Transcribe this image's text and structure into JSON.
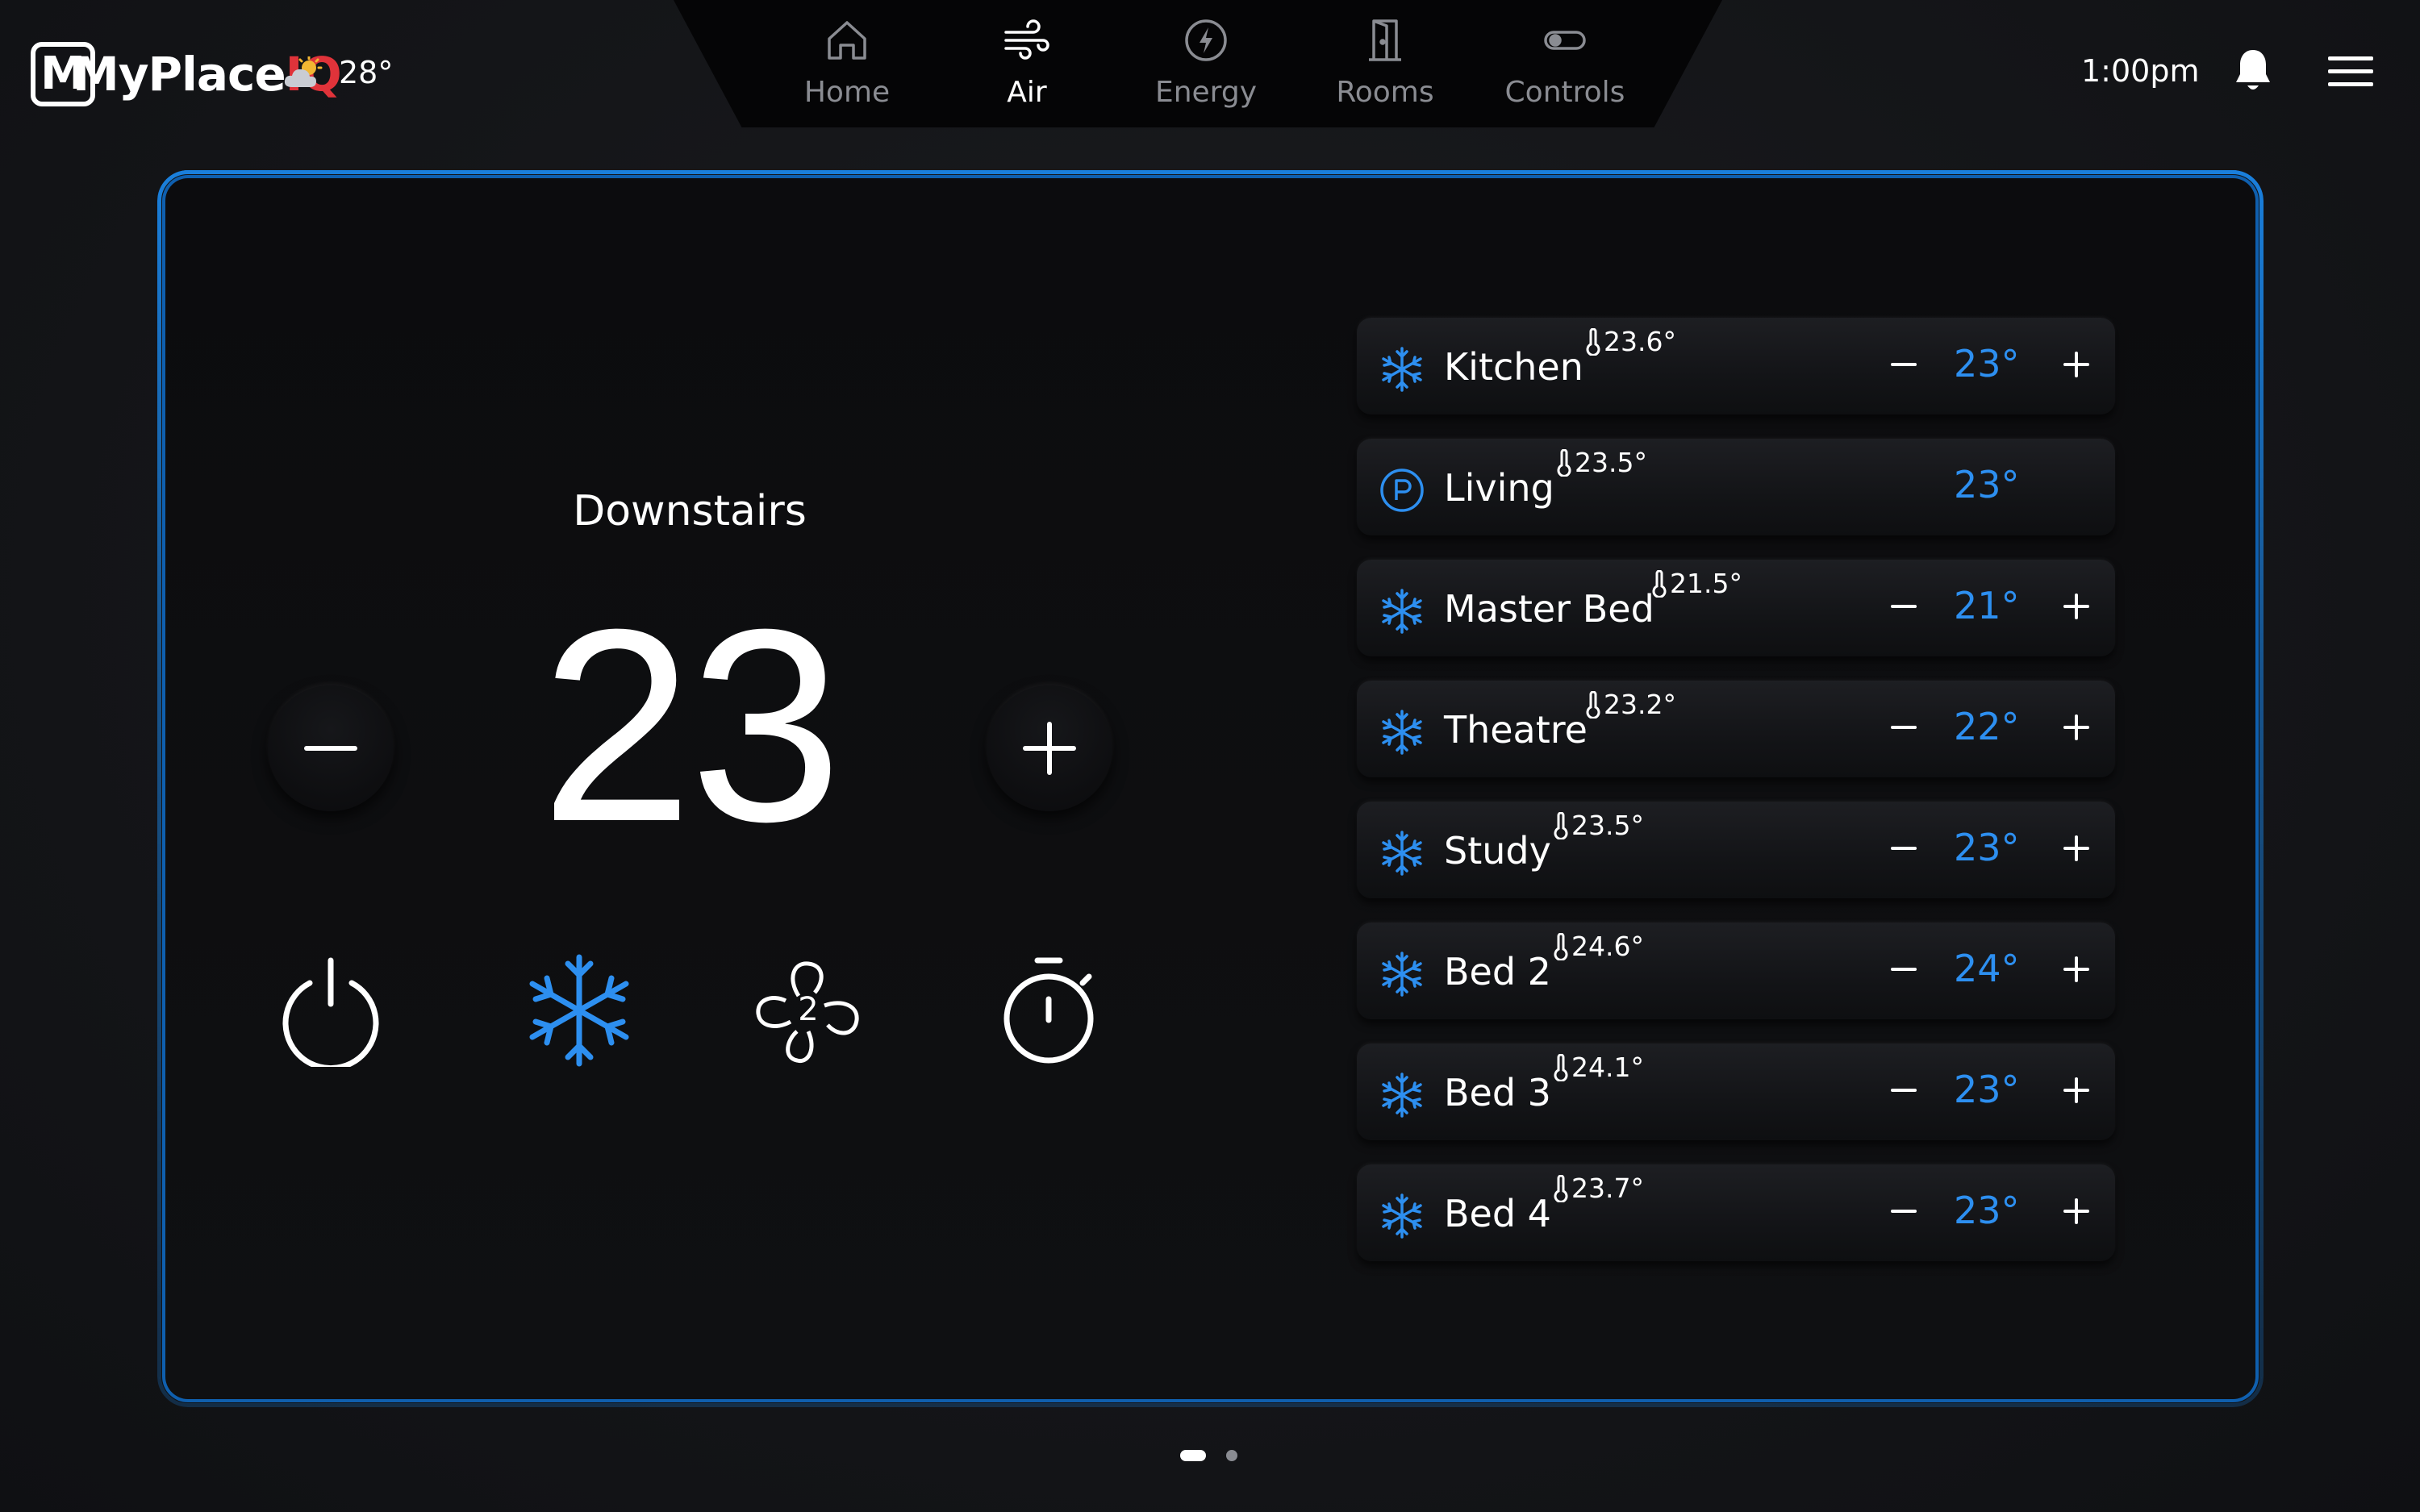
{
  "brand": {
    "logo_main": "MyPlace",
    "logo_accent": "IQ",
    "accent_color": "#e0333a"
  },
  "weather": {
    "icon": "partly-cloudy-icon",
    "temp": "28°"
  },
  "nav": [
    {
      "label": "Home",
      "icon": "house-icon",
      "active": false
    },
    {
      "label": "Air",
      "icon": "wind-icon",
      "active": true
    },
    {
      "label": "Energy",
      "icon": "lightning-icon",
      "active": false
    },
    {
      "label": "Rooms",
      "icon": "door-icon",
      "active": false
    },
    {
      "label": "Controls",
      "icon": "toggle-icon",
      "active": false
    }
  ],
  "header": {
    "time": "1:00pm"
  },
  "ac": {
    "zone_name": "Downstairs",
    "set_temp": "23",
    "mode": "cool",
    "fan_speed": "2",
    "accent": "#2d8ff0"
  },
  "zones": [
    {
      "name": "Kitchen",
      "current": "23.6°",
      "set": "23°",
      "mode": "cool",
      "adjustable": true
    },
    {
      "name": "Living",
      "current": "23.5°",
      "set": "23°",
      "mode": "constant",
      "adjustable": false
    },
    {
      "name": "Master Bed",
      "current": "21.5°",
      "set": "21°",
      "mode": "cool",
      "adjustable": true
    },
    {
      "name": "Theatre",
      "current": "23.2°",
      "set": "22°",
      "mode": "cool",
      "adjustable": true
    },
    {
      "name": "Study",
      "current": "23.5°",
      "set": "23°",
      "mode": "cool",
      "adjustable": true
    },
    {
      "name": "Bed 2",
      "current": "24.6°",
      "set": "24°",
      "mode": "cool",
      "adjustable": true
    },
    {
      "name": "Bed 3",
      "current": "24.1°",
      "set": "23°",
      "mode": "cool",
      "adjustable": true
    },
    {
      "name": "Bed 4",
      "current": "23.7°",
      "set": "23°",
      "mode": "cool",
      "adjustable": true
    }
  ],
  "pager": {
    "page": 1,
    "total": 2
  }
}
